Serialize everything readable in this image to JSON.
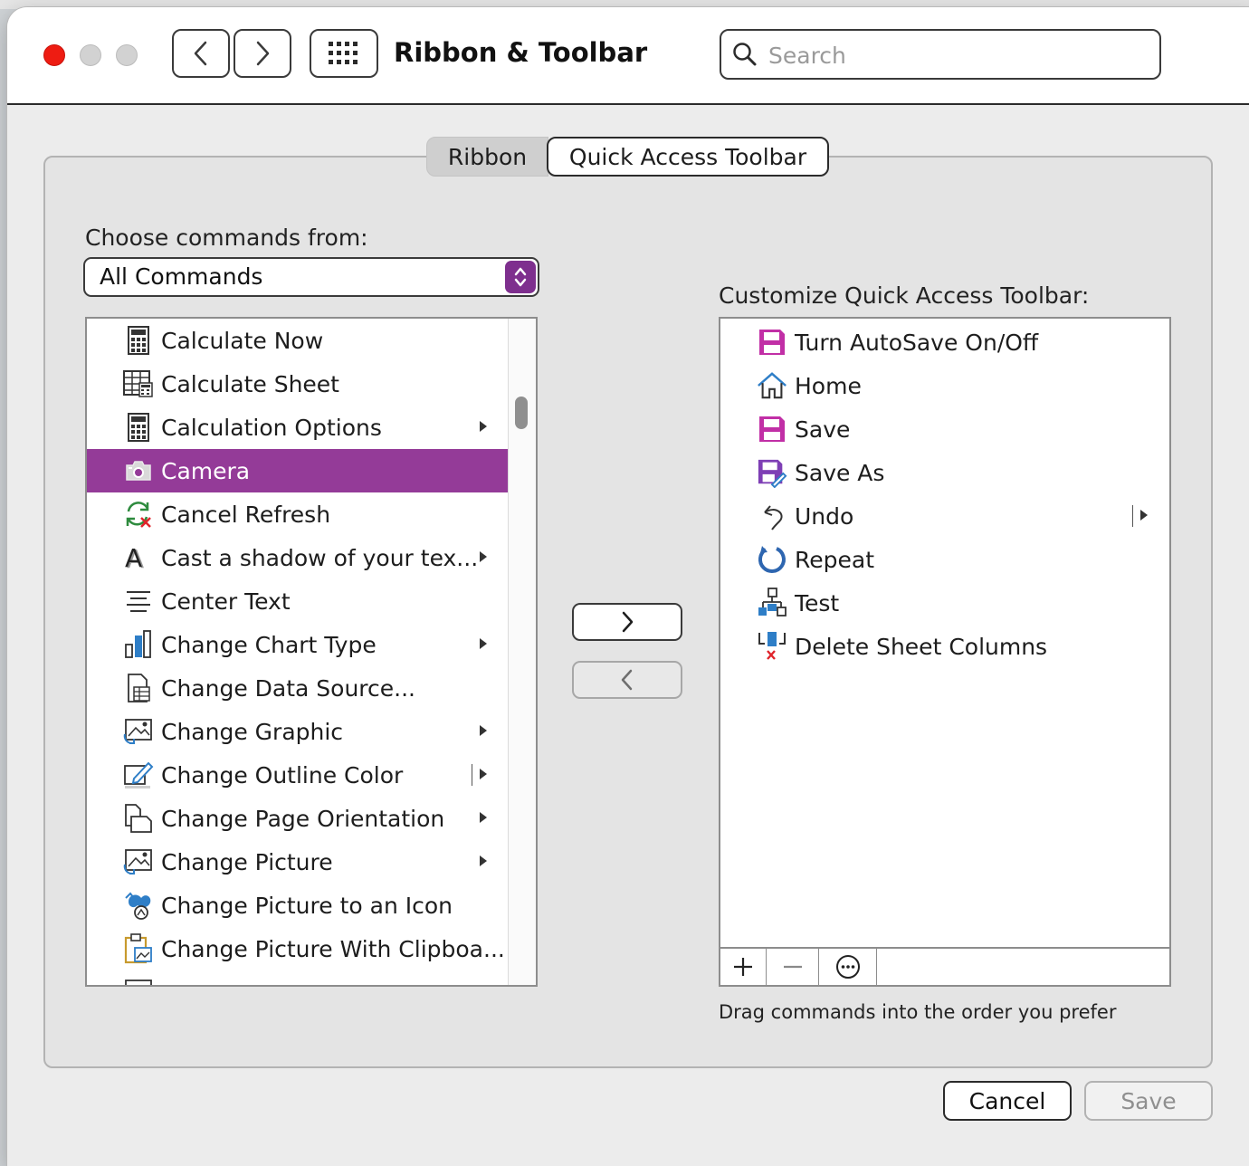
{
  "window": {
    "title": "Ribbon & Toolbar",
    "search": {
      "placeholder": "Search",
      "value": ""
    }
  },
  "tabs": [
    {
      "label": "Ribbon",
      "selected": false
    },
    {
      "label": "Quick Access Toolbar",
      "selected": true
    }
  ],
  "choose": {
    "label": "Choose commands from:",
    "selected": "All Commands",
    "accent": "#7e2f8e"
  },
  "commands": [
    {
      "label": "Calculate Now",
      "icon": "calculator-icon",
      "submenu": false
    },
    {
      "label": "Calculate Sheet",
      "icon": "calculate-sheet-icon",
      "submenu": false
    },
    {
      "label": "Calculation Options",
      "icon": "calculator-icon",
      "submenu": true
    },
    {
      "label": "Camera",
      "icon": "camera-icon",
      "submenu": false,
      "selected": true
    },
    {
      "label": "Cancel Refresh",
      "icon": "cancel-refresh-icon",
      "submenu": false
    },
    {
      "label": "Cast a shadow of your tex...",
      "icon": "text-shadow-icon",
      "submenu": true
    },
    {
      "label": "Center Text",
      "icon": "center-text-icon",
      "submenu": false
    },
    {
      "label": "Change Chart Type",
      "icon": "chart-type-icon",
      "submenu": true
    },
    {
      "label": "Change Data Source...",
      "icon": "data-source-icon",
      "submenu": false
    },
    {
      "label": "Change Graphic",
      "icon": "change-graphic-icon",
      "submenu": true
    },
    {
      "label": "Change Outline Color",
      "icon": "outline-color-icon",
      "submenu": true,
      "split": true
    },
    {
      "label": "Change Page Orientation",
      "icon": "page-orientation-icon",
      "submenu": true
    },
    {
      "label": "Change Picture",
      "icon": "change-picture-icon",
      "submenu": true
    },
    {
      "label": "Change Picture to an Icon",
      "icon": "picture-to-icon-icon",
      "submenu": false
    },
    {
      "label": "Change Picture With Clipboa...",
      "icon": "clipboard-icon",
      "submenu": false
    }
  ],
  "selection_color": "#943b98",
  "customize": {
    "label": "Customize Quick Access Toolbar:",
    "items": [
      {
        "label": "Turn AutoSave On/Off",
        "icon": "autosave-icon"
      },
      {
        "label": "Home",
        "icon": "home-icon"
      },
      {
        "label": "Save",
        "icon": "save-icon"
      },
      {
        "label": "Save As",
        "icon": "save-as-icon"
      },
      {
        "label": "Undo",
        "icon": "undo-icon",
        "split": true
      },
      {
        "label": "Repeat",
        "icon": "repeat-icon"
      },
      {
        "label": "Test",
        "icon": "test-icon"
      },
      {
        "label": "Delete Sheet Columns",
        "icon": "delete-columns-icon"
      }
    ],
    "hint": "Drag commands into the order you prefer"
  },
  "buttons": {
    "cancel": "Cancel",
    "save": "Save"
  }
}
